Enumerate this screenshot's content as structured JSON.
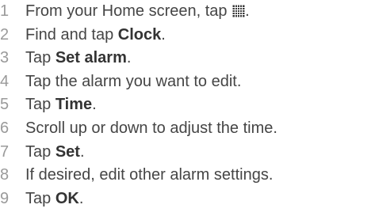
{
  "steps": [
    {
      "number": "1",
      "text_before": "From your Home screen, tap ",
      "icon": "apps-grid-icon",
      "text_after": "."
    },
    {
      "number": "2",
      "text_before": "Find and tap ",
      "emphasis": "Clock",
      "text_after": "."
    },
    {
      "number": "3",
      "text_before": "Tap ",
      "emphasis": "Set alarm",
      "text_after": "."
    },
    {
      "number": "4",
      "text_before": "Tap the alarm you want to edit."
    },
    {
      "number": "5",
      "text_before": "Tap ",
      "emphasis": "Time",
      "text_after": "."
    },
    {
      "number": "6",
      "text_before": "Scroll up or down to adjust the time."
    },
    {
      "number": "7",
      "text_before": "Tap ",
      "emphasis": "Set",
      "text_after": "."
    },
    {
      "number": "8",
      "text_before": "If desired, edit other alarm settings."
    },
    {
      "number": "9",
      "text_before": "Tap ",
      "emphasis": "OK",
      "text_after": "."
    }
  ],
  "colors": {
    "number": "#9a9a9a",
    "text": "#454545",
    "emphasis": "#333333",
    "background": "#ffffff"
  }
}
